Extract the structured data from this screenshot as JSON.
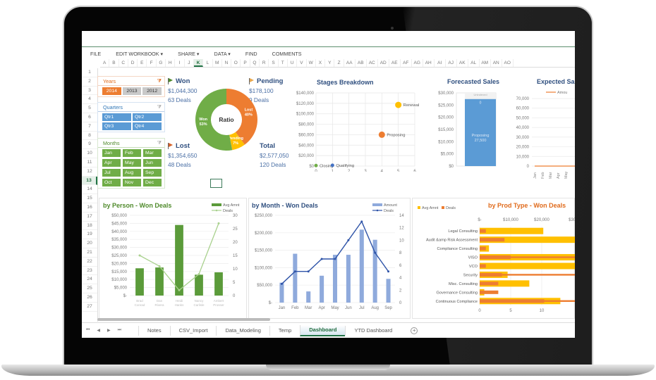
{
  "menu": [
    "FILE",
    "EDIT WORKBOOK ▾",
    "SHARE ▾",
    "DATA ▾",
    "FIND",
    "COMMENTS"
  ],
  "columns": [
    "A",
    "B",
    "C",
    "D",
    "E",
    "F",
    "G",
    "H",
    "I",
    "J",
    "K",
    "L",
    "M",
    "N",
    "O",
    "P",
    "Q",
    "R",
    "S",
    "T",
    "U",
    "V",
    "W",
    "X",
    "Y",
    "Z",
    "AA",
    "AB",
    "AC",
    "AD",
    "AE",
    "AF",
    "AG",
    "AH",
    "AI",
    "AJ",
    "AK",
    "AL",
    "AM",
    "AN",
    "AO"
  ],
  "selected_column": "K",
  "rows": [
    "1",
    "2",
    "3",
    "4",
    "5",
    "6",
    "7",
    "8",
    "9",
    "10",
    "11",
    "12",
    "13",
    "14",
    "15",
    "16",
    "17",
    "18",
    "19",
    "20",
    "21",
    "22",
    "23",
    "24",
    "25",
    "26",
    "27"
  ],
  "selected_row": "13",
  "slicers": {
    "years": {
      "title": "Years",
      "items": [
        "2014",
        "2013",
        "2012"
      ],
      "selected": "2014"
    },
    "quarters": {
      "title": "Quarters",
      "items": [
        "Qtr1",
        "Qtr2",
        "Qtr3",
        "Qtr4"
      ]
    },
    "months": {
      "title": "Months",
      "items": [
        "Jan",
        "Feb",
        "Mar",
        "Apr",
        "May",
        "Jun",
        "Jul",
        "Aug",
        "Sep",
        "Oct",
        "Nov",
        "Dec"
      ]
    }
  },
  "kpis": {
    "won": {
      "title": "Won",
      "amount": "$1,044,300",
      "deals": "63 Deals",
      "color": "#4f8a2b"
    },
    "pending": {
      "title": "Pending",
      "amount": "$178,100",
      "deals": "9 Deals",
      "color": "#e8a850"
    },
    "lost": {
      "title": "Lost",
      "amount": "$1,354,650",
      "deals": "48 Deals",
      "color": "#d5622a"
    },
    "total": {
      "title": "Total",
      "amount": "$2,577,050",
      "deals": "120 Deals"
    }
  },
  "chart_data": [
    {
      "type": "pie",
      "title": "Ratio",
      "categories": [
        "Won",
        "Lost",
        "Pending"
      ],
      "values": [
        53,
        40,
        7
      ],
      "labels": [
        "Won\n53%",
        "Lost\n40%",
        "Pending\n7%"
      ],
      "colors": [
        "#70ad47",
        "#ed7d31",
        "#ffc000"
      ]
    },
    {
      "type": "scatter",
      "title": "Stages Breakdown",
      "points": [
        {
          "label": "Closing",
          "x": 0,
          "y": 1000,
          "color": "#70ad47"
        },
        {
          "label": "Qualifying",
          "x": 1,
          "y": 1500,
          "color": "#4472c4"
        },
        {
          "label": "Proposing",
          "x": 4,
          "y": 60000,
          "color": "#ed7d31"
        },
        {
          "label": "Renewal",
          "x": 5,
          "y": 117000,
          "color": "#ffc000"
        }
      ],
      "xlim": [
        0,
        6
      ],
      "ylim": [
        0,
        140000
      ],
      "xticks": [
        "0",
        "1",
        "2",
        "3",
        "4",
        "5",
        "6"
      ],
      "yticks": [
        "$0",
        "$20,000",
        "$40,000",
        "$60,000",
        "$80,000",
        "$100,000",
        "$120,000",
        "$140,000"
      ]
    },
    {
      "type": "bar",
      "title": "Forecasted Sales",
      "series": [
        {
          "name": "Proposing",
          "value": 27500,
          "label": "Proposing\n27,500",
          "color": "#5b9bd5"
        },
        {
          "name": "Unindexed",
          "value": 0,
          "label": "0",
          "color": "#d9d9d9"
        }
      ],
      "ylim": [
        0,
        30000
      ],
      "yticks": [
        "$0",
        "$5,000",
        "$10,000",
        "$15,000",
        "$20,000",
        "$25,000",
        "$30,000"
      ]
    },
    {
      "type": "line",
      "title": "Expected Sa",
      "legend": [
        "Amou"
      ],
      "categories": [
        "Jan",
        "Feb",
        "Mar",
        "Apr",
        "May"
      ],
      "values": [
        0,
        0,
        0,
        0,
        0
      ],
      "ylim": [
        0,
        70000
      ],
      "yticks": [
        "0",
        "10,000",
        "20,000",
        "30,000",
        "40,000",
        "50,000",
        "60,000",
        "70,000"
      ],
      "color": "#ed7d31"
    },
    {
      "type": "bar",
      "title": "by Person - Won Deals",
      "legend": [
        "Avg Amnt",
        "Deals"
      ],
      "categories": [
        "Brad Conrad",
        "Dan Rivera",
        "Heidi Hanks",
        "Nancy Carlisle",
        "Ambert Prosser"
      ],
      "series": [
        {
          "name": "Avg Amnt",
          "type": "bar",
          "axis": "left",
          "values": [
            17000,
            17500,
            44000,
            13000,
            14500
          ],
          "color": "#5b9b3a"
        },
        {
          "name": "Deals",
          "type": "line",
          "axis": "right",
          "values": [
            15,
            11,
            2,
            8,
            27
          ],
          "color": "#a9d18e"
        }
      ],
      "ylim": [
        0,
        50000
      ],
      "y2lim": [
        0,
        30
      ],
      "yticks": [
        "$-",
        "$5,000",
        "$10,000",
        "$15,000",
        "$20,000",
        "$25,000",
        "$30,000",
        "$35,000",
        "$40,000",
        "$45,000",
        "$50,000"
      ],
      "y2ticks": [
        "0",
        "5",
        "10",
        "15",
        "20",
        "25",
        "30"
      ]
    },
    {
      "type": "bar",
      "title": "by Month - Won Deals",
      "legend": [
        "Amount",
        "Deals"
      ],
      "categories": [
        "Jan",
        "Feb",
        "Mar",
        "Apr",
        "May",
        "Jun",
        "Jul",
        "Aug",
        "Sep"
      ],
      "series": [
        {
          "name": "Amount",
          "type": "bar",
          "axis": "left",
          "values": [
            57000,
            140000,
            32000,
            77000,
            137000,
            137000,
            209000,
            180000,
            68000
          ],
          "color": "#8faadc"
        },
        {
          "name": "Deals",
          "type": "line",
          "axis": "right",
          "values": [
            3,
            5,
            5,
            7,
            7,
            10,
            13,
            8,
            5
          ],
          "color": "#2f54a8"
        }
      ],
      "ylim": [
        0,
        250000
      ],
      "y2lim": [
        0,
        14
      ],
      "yticks": [
        "$-",
        "$50,000",
        "$100,000",
        "$150,000",
        "$200,000",
        "$250,000"
      ],
      "y2ticks": [
        "0",
        "2",
        "4",
        "6",
        "8",
        "10",
        "12",
        "14"
      ]
    },
    {
      "type": "bar",
      "orientation": "horizontal",
      "title": "by Prod Type - Won Deals",
      "legend": [
        "Avg Amnt",
        "Deals"
      ],
      "categories": [
        "Legal Consulting",
        "Audit &amp Risk Assessment",
        "Compliance Consulting",
        "VISO",
        "VCO",
        "Security",
        "Misc. Consulting",
        "Governance Consulting",
        "Continuous Compliance"
      ],
      "series": [
        {
          "name": "Avg Amnt",
          "axis": "top",
          "values": [
            20500,
            32000,
            3000,
            32000,
            32000,
            9000,
            16000,
            1500,
            26000
          ],
          "color": "#ffc000"
        },
        {
          "name": "Deals",
          "axis": "bottom",
          "values": [
            1,
            4,
            1,
            5,
            1,
            3.6,
            3,
            3,
            10.4
          ],
          "extends": [
            false,
            false,
            false,
            true,
            false,
            true,
            false,
            false,
            true
          ],
          "color": "#ed7d31"
        }
      ],
      "xlim_top": [
        0,
        30000
      ],
      "xticks_top": [
        "$-",
        "$10,000",
        "$20,000",
        "$30,"
      ],
      "xlim_bottom": [
        0,
        12
      ],
      "xticks_bottom": [
        "0",
        "5",
        "10"
      ]
    }
  ],
  "sheet_tabs": [
    "Notes",
    "CSV_Import",
    "Data_Modeling",
    "Temp",
    "Dashboard",
    "YTD Dashboard"
  ],
  "active_tab": "Dashboard",
  "tab_nav": [
    "⏮",
    "◀",
    "▶",
    "⏭"
  ],
  "add_sheet": "+"
}
